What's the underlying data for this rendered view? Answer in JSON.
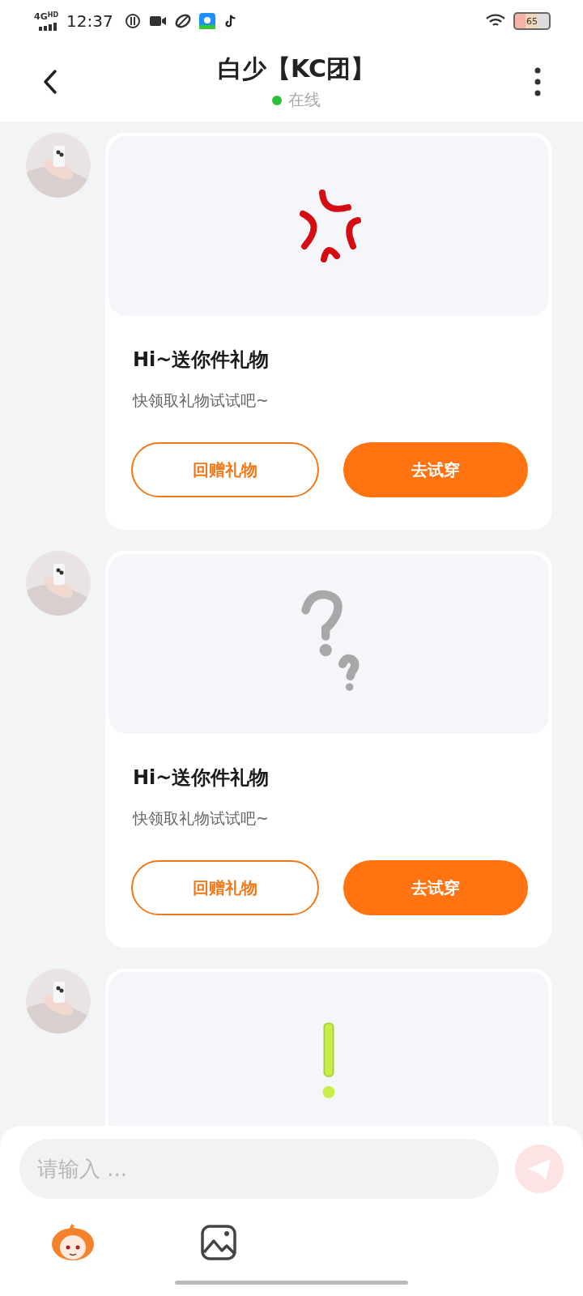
{
  "status_bar": {
    "network": "4G",
    "network_badge": "HD",
    "time": "12:37",
    "battery": "65"
  },
  "header": {
    "title": "白少【KC团】",
    "presence": "在线",
    "online": true
  },
  "messages": [
    {
      "kind": "anger",
      "title": "Hi~送你件礼物",
      "subtitle": "快领取礼物试试吧~",
      "buttons": [
        {
          "label": "回赠礼物",
          "kind": "outline"
        },
        {
          "label": "去试穿",
          "kind": "filled"
        }
      ]
    },
    {
      "kind": "question",
      "title": "Hi~送你件礼物",
      "subtitle": "快领取礼物试试吧~",
      "buttons": [
        {
          "label": "回赠礼物",
          "kind": "outline"
        },
        {
          "label": "去试穿",
          "kind": "filled"
        }
      ]
    },
    {
      "kind": "exclaim"
    }
  ],
  "composer": {
    "placeholder": "请输入 ..."
  }
}
